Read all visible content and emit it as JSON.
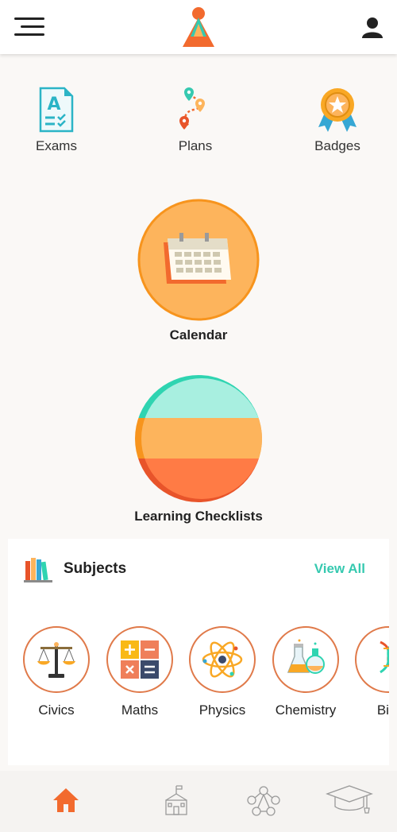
{
  "header": {
    "menu_icon": "hamburger-icon",
    "logo_icon": "pyramid-logo-icon",
    "profile_icon": "user-icon"
  },
  "quick_links": [
    {
      "label": "Exams",
      "icon": "exam-paper-icon"
    },
    {
      "label": "Plans",
      "icon": "route-pins-icon"
    },
    {
      "label": "Badges",
      "icon": "badge-ribbon-icon"
    }
  ],
  "calendar": {
    "label": "Calendar",
    "icon": "calendar-icon"
  },
  "checklists": {
    "label": "Learning Checklists",
    "icon": "striped-circle-icon"
  },
  "subjects": {
    "title": "Subjects",
    "view_all": "View All",
    "icon": "books-icon",
    "items": [
      {
        "label": "Civics",
        "icon": "scales-icon"
      },
      {
        "label": "Maths",
        "icon": "calculator-icon"
      },
      {
        "label": "Physics",
        "icon": "atom-icon"
      },
      {
        "label": "Chemistry",
        "icon": "flask-icon"
      },
      {
        "label": "Biol",
        "icon": "dna-icon"
      }
    ]
  },
  "bottom_nav": [
    {
      "icon": "home-icon",
      "active": true
    },
    {
      "icon": "school-icon",
      "active": false
    },
    {
      "icon": "network-icon",
      "active": false
    },
    {
      "icon": "graduation-cap-icon",
      "active": false
    }
  ],
  "colors": {
    "accent_orange": "#f26a2e",
    "teal": "#36c9b0",
    "subject_border": "#e07a4a",
    "calendar_circle": "#fdb45c"
  }
}
